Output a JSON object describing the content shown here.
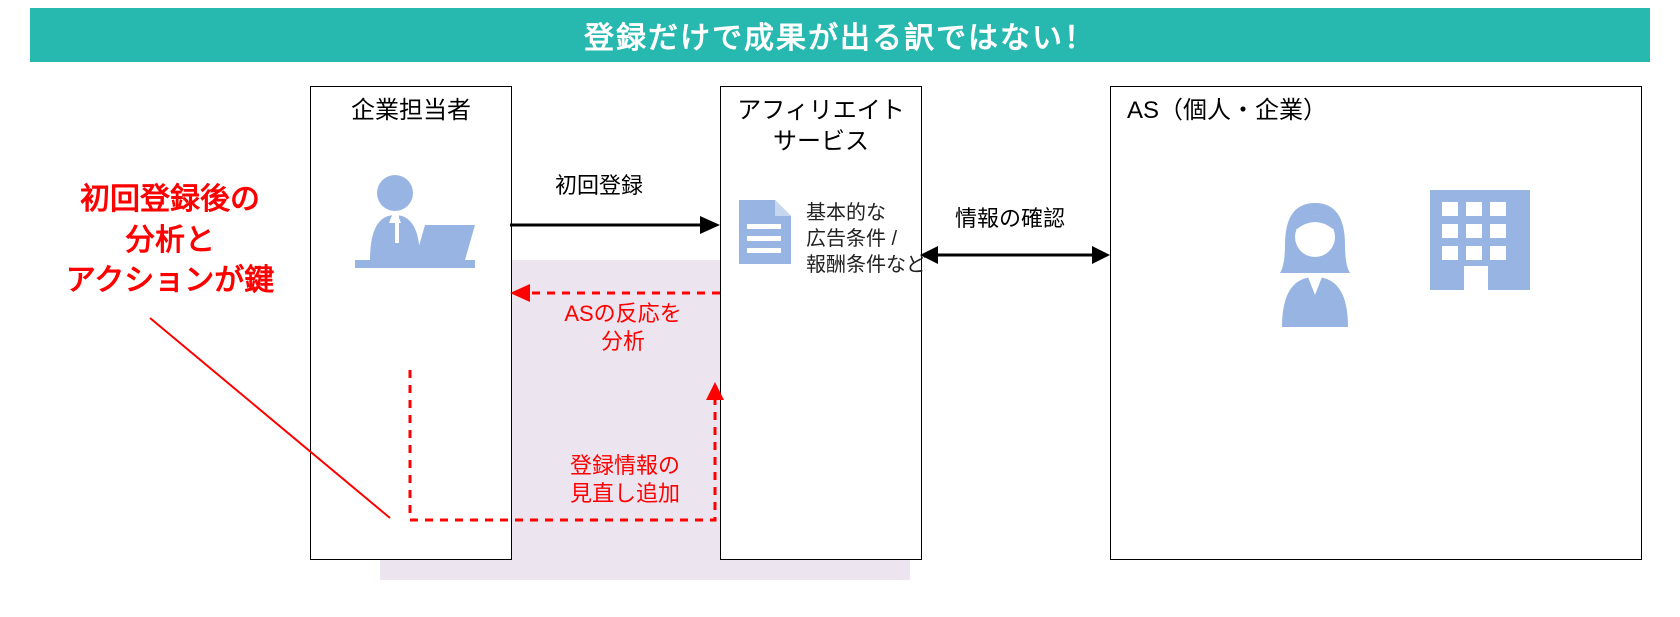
{
  "banner": {
    "title": "登録だけで成果が出る訳ではない！"
  },
  "callout": {
    "line1": "初回登録後の",
    "line2": "分析と",
    "line3": "アクションが鍵"
  },
  "boxes": {
    "company": {
      "title": "企業担当者"
    },
    "affiliate": {
      "title_line1": "アフィリエイト",
      "title_line2": "サービス"
    },
    "as": {
      "title": "AS（個人・企業）"
    }
  },
  "arrows": {
    "initial_register": "初回登録",
    "analyze_line1": "ASの反応を",
    "analyze_line2": "分析",
    "review_line1": "登録情報の",
    "review_line2": "見直し追加",
    "confirm_info": "情報の確認"
  },
  "affiliate_desc": {
    "line1": "基本的な",
    "line2": "広告条件 /",
    "line3": "報酬条件など"
  },
  "colors": {
    "accent": "#27b8b0",
    "emphasis": "#f00",
    "icon": "#97b4e3"
  }
}
